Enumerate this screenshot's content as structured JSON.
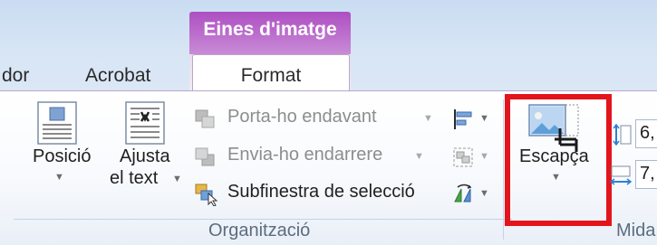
{
  "tabs": {
    "partial_left": "dor",
    "acrobat": "Acrobat",
    "context_group": "Eines d'imatge",
    "format": "Format"
  },
  "ribbon": {
    "position_btn": "Posició",
    "wrap_line1": "Ajusta",
    "wrap_line2": "el text",
    "bring_forward": "Porta-ho endavant",
    "send_backward": "Envia-ho endarrere",
    "selection_pane": "Subfinestra de selecció",
    "crop": "Escapça",
    "height_value": "6,",
    "width_value": "7,",
    "group_arrange": "Organització",
    "group_size": "Mida"
  },
  "colors": {
    "context_tab": "#ad4fc2",
    "highlight": "#e3151c"
  }
}
